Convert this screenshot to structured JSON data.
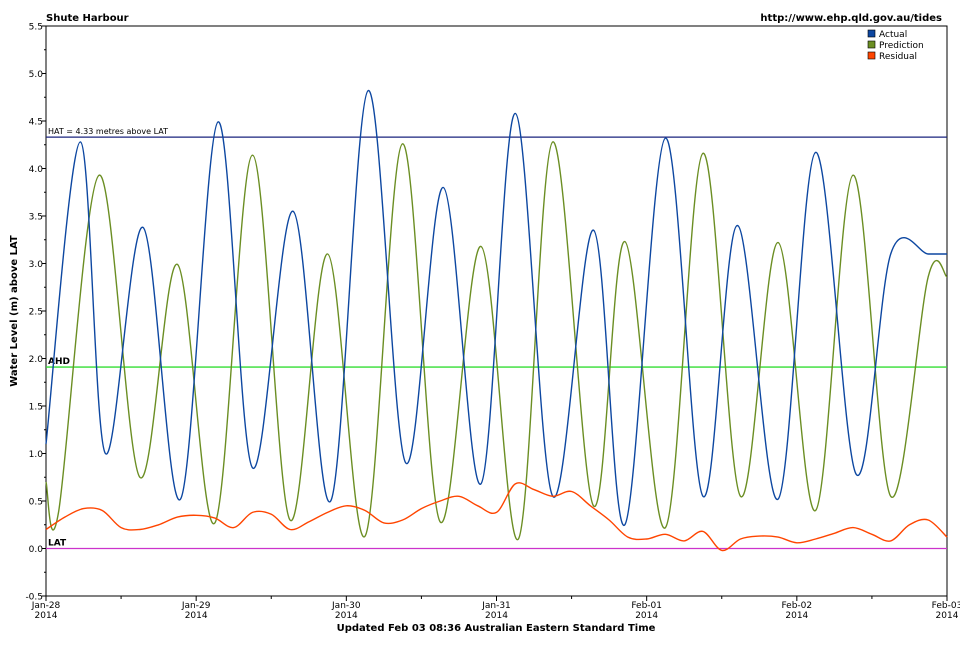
{
  "chart_data": {
    "type": "line",
    "title": "Shute Harbour",
    "source_url": "http://www.ehp.qld.gov.au/tides",
    "footer": "Updated Feb 03 08:36 Australian Eastern Standard Time",
    "ylabel": "Water Level (m) above LAT",
    "ylim": [
      -0.5,
      5.5
    ],
    "y_ticks": [
      "-0.5",
      "0.0",
      "0.5",
      "1.0",
      "1.5",
      "2.0",
      "2.5",
      "3.0",
      "3.5",
      "4.0",
      "4.5",
      "5.0",
      "5.5"
    ],
    "x_range_hours": [
      0,
      144
    ],
    "x_ticks": [
      {
        "label": "Jan-28",
        "year": "2014"
      },
      {
        "label": "Jan-29",
        "year": "2014"
      },
      {
        "label": "Jan-30",
        "year": "2014"
      },
      {
        "label": "Jan-31",
        "year": "2014"
      },
      {
        "label": "Feb-01",
        "year": "2014"
      },
      {
        "label": "Feb-02",
        "year": "2014"
      },
      {
        "label": "Feb-03",
        "year": "2014"
      }
    ],
    "grid": false,
    "legend_position": "top-right",
    "reference_lines": [
      {
        "name": "HAT",
        "label": "HAT = 4.33 metres above LAT",
        "y": 4.33,
        "color": "#1a237e"
      },
      {
        "name": "AHD",
        "label": "AHD",
        "y": 1.91,
        "color": "#33dd33"
      },
      {
        "name": "LAT",
        "label": "LAT",
        "y": 0.0,
        "color": "#cc33cc"
      }
    ],
    "series": [
      {
        "name": "Actual",
        "color": "#0d47a1",
        "x": [
          0,
          5.5,
          9.5,
          15.5,
          21.5,
          27.5,
          33,
          39.5,
          45.5,
          51.5,
          57.5,
          63.5,
          69.5,
          75,
          81,
          87.5,
          92.5,
          99,
          105,
          110.5,
          117,
          123,
          129.5,
          135,
          141,
          144
        ],
        "y": [
          1.1,
          4.28,
          1.0,
          3.38,
          0.52,
          4.49,
          0.85,
          3.55,
          0.5,
          4.82,
          0.9,
          3.8,
          0.68,
          4.58,
          0.55,
          3.35,
          0.25,
          4.32,
          0.55,
          3.4,
          0.52,
          4.17,
          0.78,
          3.1,
          3.1,
          3.1
        ]
      },
      {
        "name": "Prediction",
        "color": "#6b8e23",
        "x": [
          0,
          2,
          8.5,
          15,
          21,
          27,
          33,
          39,
          45,
          51,
          57,
          63,
          69.5,
          75.5,
          81,
          87.5,
          92.5,
          99,
          105,
          111,
          117,
          123,
          129,
          135,
          141,
          144
        ],
        "y": [
          0.7,
          0.38,
          3.93,
          0.75,
          2.99,
          0.27,
          4.14,
          0.3,
          3.1,
          0.13,
          4.26,
          0.28,
          3.18,
          0.1,
          4.28,
          0.45,
          3.23,
          0.22,
          4.16,
          0.55,
          3.22,
          0.4,
          3.93,
          0.55,
          2.86,
          2.86
        ]
      },
      {
        "name": "Residual",
        "color": "#ff4500",
        "x": [
          0,
          3,
          6,
          9,
          12,
          15,
          18,
          21,
          24,
          27,
          30,
          33,
          36,
          39,
          42,
          45,
          48,
          51,
          54,
          57,
          60,
          63,
          66,
          69,
          72,
          75,
          78,
          81,
          84,
          87,
          90,
          93,
          96,
          99,
          102,
          105,
          108,
          111,
          114,
          117,
          120,
          123,
          126,
          129,
          132,
          135,
          138,
          141,
          144
        ],
        "y": [
          0.2,
          0.33,
          0.42,
          0.4,
          0.22,
          0.2,
          0.25,
          0.33,
          0.35,
          0.32,
          0.22,
          0.38,
          0.36,
          0.2,
          0.28,
          0.38,
          0.45,
          0.4,
          0.27,
          0.3,
          0.42,
          0.5,
          0.55,
          0.45,
          0.38,
          0.68,
          0.62,
          0.55,
          0.6,
          0.45,
          0.3,
          0.12,
          0.1,
          0.15,
          0.08,
          0.18,
          -0.02,
          0.1,
          0.13,
          0.12,
          0.06,
          0.1,
          0.16,
          0.22,
          0.15,
          0.08,
          0.25,
          0.3,
          0.12
        ]
      }
    ]
  }
}
